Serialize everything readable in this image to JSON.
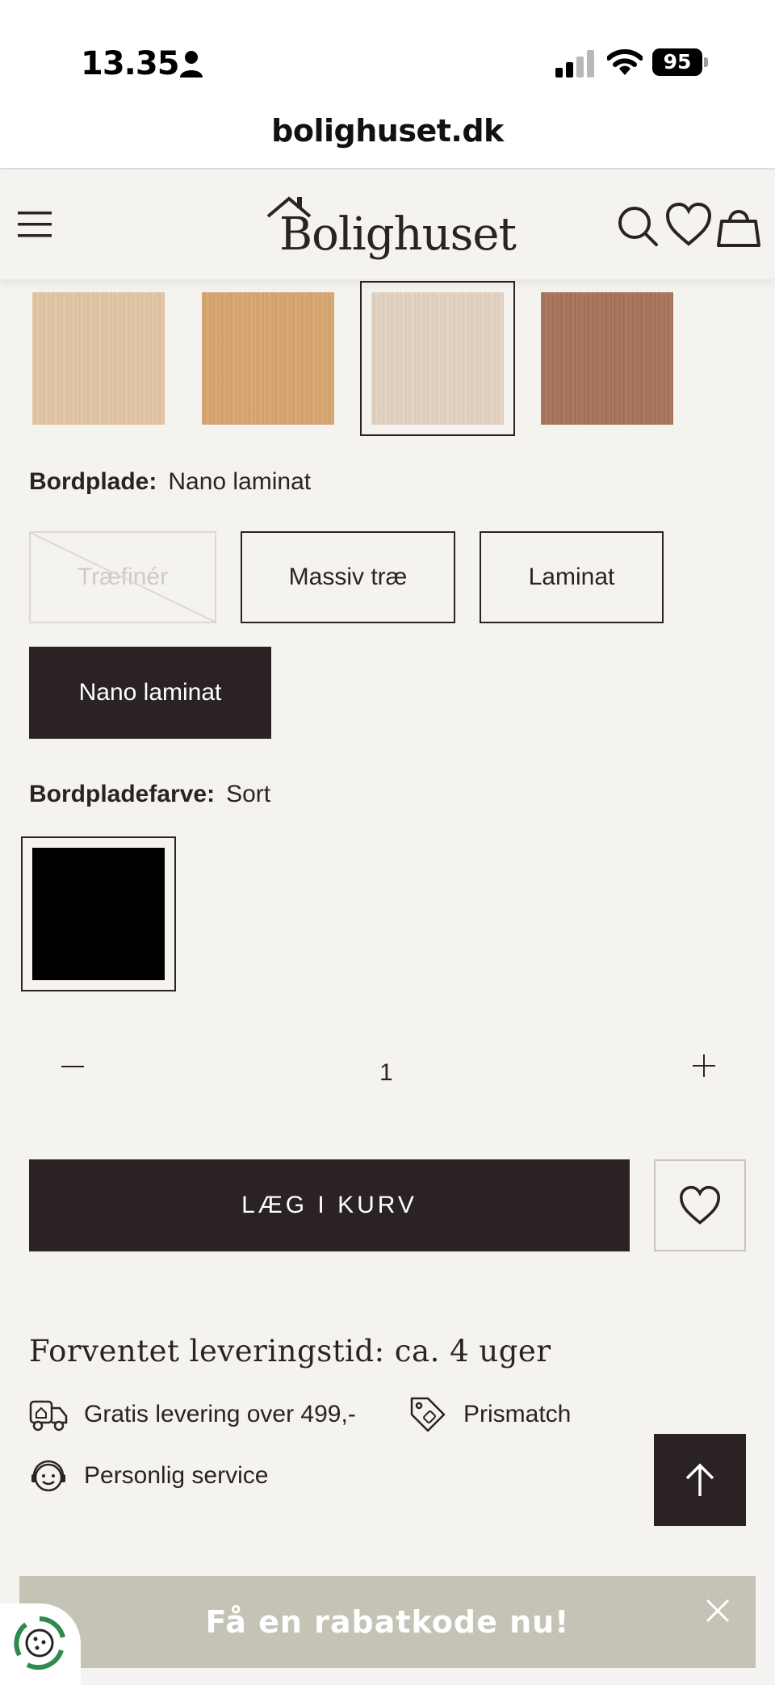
{
  "status_bar": {
    "time": "13.35",
    "battery": "95"
  },
  "browser": {
    "url": "bolighuset.dk"
  },
  "header": {
    "logo_text": "Bolighuset"
  },
  "swatches": [
    {
      "name": "light-oak",
      "color": "#e3c6a3"
    },
    {
      "name": "oak",
      "color": "#d8a56f"
    },
    {
      "name": "white-oak",
      "color": "#e4d3c2",
      "selected": true
    },
    {
      "name": "walnut",
      "color": "#a67358"
    }
  ],
  "tabletop": {
    "label": "Bordplade:",
    "value": "Nano laminat",
    "options": [
      {
        "label": "Træfinér",
        "state": "disabled"
      },
      {
        "label": "Massiv træ",
        "state": "available"
      },
      {
        "label": "Laminat",
        "state": "available"
      },
      {
        "label": "Nano laminat",
        "state": "selected"
      }
    ]
  },
  "tabletop_color": {
    "label": "Bordpladefarve:",
    "value": "Sort",
    "swatch_color": "#000000"
  },
  "quantity": {
    "value": "1"
  },
  "add_to_cart": {
    "label": "LÆG I KURV"
  },
  "delivery": {
    "text": "Forventet leveringstid: ca.  4  uger"
  },
  "usps": [
    {
      "icon": "delivery-truck-icon",
      "label": "Gratis levering over 499,-"
    },
    {
      "icon": "price-tag-icon",
      "label": "Prismatch"
    },
    {
      "icon": "headset-service-icon",
      "label": "Personlig service"
    }
  ],
  "promo": {
    "label": "Få en rabatkode nu!"
  },
  "colors": {
    "brand_dark": "#2b2323",
    "background": "#f5f3ef",
    "promo_bg": "#c4c3b6"
  }
}
